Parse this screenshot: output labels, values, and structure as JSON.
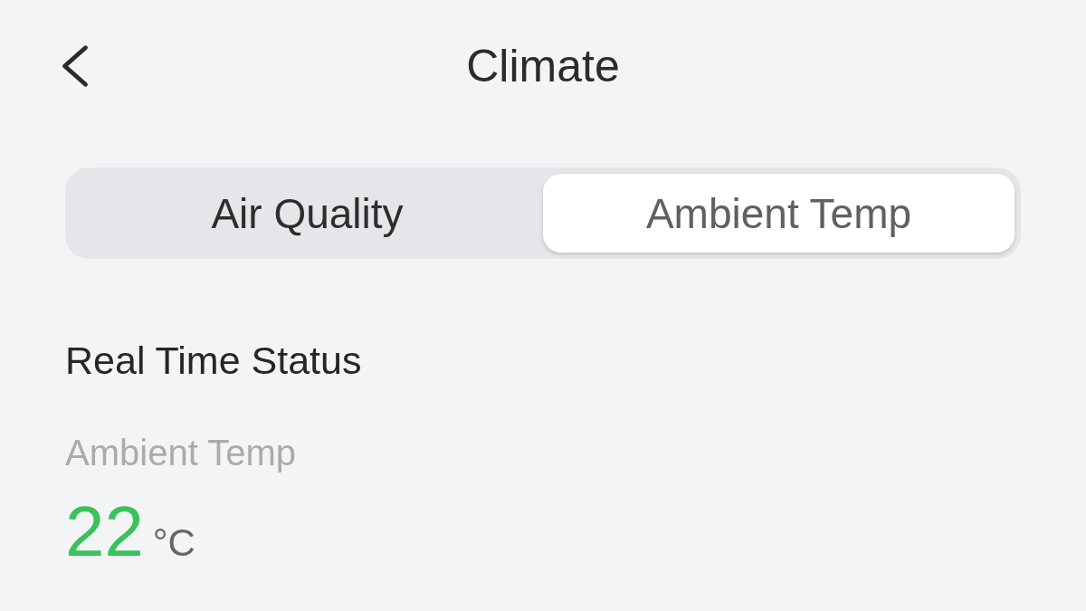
{
  "header": {
    "title": "Climate"
  },
  "tabs": [
    {
      "label": "Air Quality",
      "selected": false
    },
    {
      "label": "Ambient Temp",
      "selected": true
    }
  ],
  "real_time_status": {
    "heading": "Real Time Status",
    "readings": [
      {
        "label": "Ambient Temp",
        "value": "22",
        "unit": "°C"
      }
    ]
  }
}
